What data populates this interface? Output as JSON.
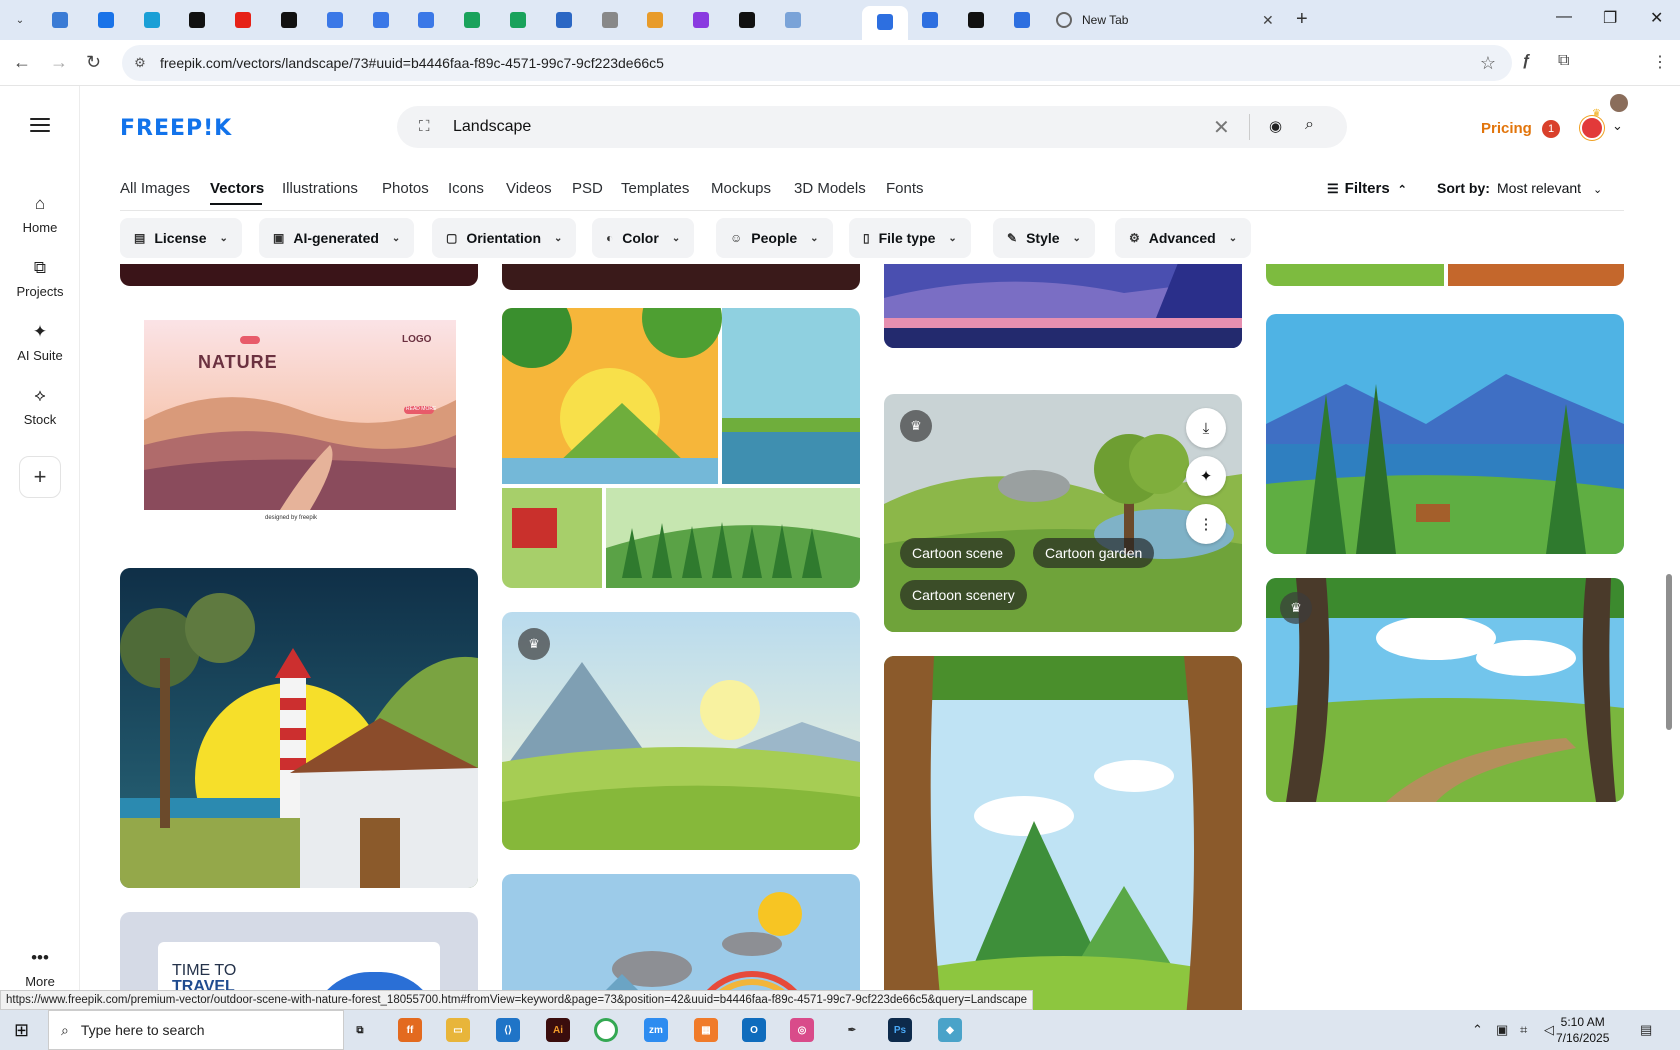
{
  "browser": {
    "active_tab_title": "",
    "new_tab_label": "New Tab",
    "url": "freepik.com/vectors/landscape/73#uuid=b4446faa-f89c-4571-99c7-9cf223de66c5",
    "status_url": "https://www.freepik.com/premium-vector/outdoor-scene-with-nature-forest_18055700.htm#fromView=keyword&page=73&position=42&uuid=b4446faa-f89c-4571-99c7-9cf223de66c5&query=Landscape",
    "pinned_tabs": [
      {
        "icon": "globe-icon",
        "color": "#3a7bd5"
      },
      {
        "icon": "shield-icon",
        "color": "#1a73e8"
      },
      {
        "icon": "play-icon",
        "color": "#1a9fd6"
      },
      {
        "icon": "threads-icon",
        "color": "#111111"
      },
      {
        "icon": "youtube-icon",
        "color": "#e62117"
      },
      {
        "icon": "bolt-icon",
        "color": "#111111"
      },
      {
        "icon": "docs-icon",
        "color": "#3b78e7"
      },
      {
        "icon": "docs-icon",
        "color": "#3b78e7"
      },
      {
        "icon": "docs-icon",
        "color": "#3b78e7"
      },
      {
        "icon": "sheets-icon",
        "color": "#19a25b"
      },
      {
        "icon": "sheets-icon",
        "color": "#19a25b"
      },
      {
        "icon": "word-icon",
        "color": "#2b67c4"
      },
      {
        "icon": "web-icon",
        "color": "#888888"
      },
      {
        "icon": "crown-icon",
        "color": "#e89b2a"
      },
      {
        "icon": "code-icon",
        "color": "#8a3ae0"
      },
      {
        "icon": "a-icon",
        "color": "#111111"
      },
      {
        "icon": "grid-icon",
        "color": "#7aa3d8"
      },
      {
        "icon": "form-icon",
        "color": "#2d6fe0"
      },
      {
        "icon": "form-icon",
        "color": "#2d6fe0"
      },
      {
        "icon": "form-icon",
        "color": "#2d6fe0"
      },
      {
        "icon": "m-icon",
        "color": "#111111"
      },
      {
        "icon": "form-icon",
        "color": "#2d6fe0"
      }
    ]
  },
  "rail": {
    "items": [
      {
        "label": "Home",
        "icon": "home-icon"
      },
      {
        "label": "Projects",
        "icon": "projects-icon"
      },
      {
        "label": "AI Suite",
        "icon": "sparkle-icon"
      },
      {
        "label": "Stock",
        "icon": "stock-icon"
      }
    ],
    "more_label": "More"
  },
  "header": {
    "logo": "FREEP!K",
    "search_value": "Landscape",
    "pricing_label": "Pricing",
    "notification_count": "1"
  },
  "categories": [
    "All Images",
    "Vectors",
    "Illustrations",
    "Photos",
    "Icons",
    "Videos",
    "PSD",
    "Templates",
    "Mockups",
    "3D Models",
    "Fonts"
  ],
  "active_category": "Vectors",
  "sort": {
    "filters_label": "Filters",
    "sort_label": "Sort by:",
    "sort_value": "Most relevant"
  },
  "filters": [
    "License",
    "AI-generated",
    "Orientation",
    "Color",
    "People",
    "File type",
    "Style",
    "Advanced"
  ],
  "cards": {
    "nature_title": "NATURE",
    "nature_logo": "LOGO",
    "nature_button": "READ MORE",
    "nature_credit": "designed by freepik",
    "travel_title_1": "TIME TO",
    "travel_title_2": "TRAVEL",
    "hover_tags": [
      "Cartoon scene",
      "Cartoon garden",
      "Cartoon scenery"
    ]
  },
  "taskbar": {
    "search_placeholder": "Type here to search",
    "time": "5:10 AM",
    "date": "7/16/2025"
  },
  "colors": {
    "brand": "#1273eb",
    "pricing": "#e2750b"
  }
}
